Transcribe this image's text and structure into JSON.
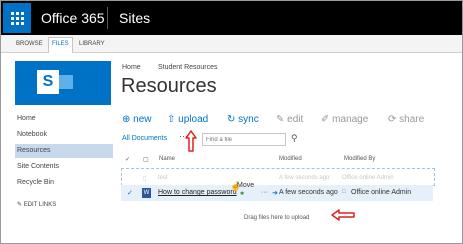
{
  "suite_bar": {
    "app_name": "Office 365",
    "section": "Sites"
  },
  "ribbon": {
    "tabs": [
      "BROWSE",
      "FILES",
      "LIBRARY"
    ],
    "active": "FILES"
  },
  "left_nav": {
    "items": [
      "Home",
      "Notebook",
      "Resources",
      "Site Contents",
      "Recycle Bin"
    ],
    "selected": "Resources",
    "edit_links": "EDIT LINKS"
  },
  "breadcrumb": [
    "Home",
    "Student Resources"
  ],
  "page_title": "Resources",
  "commands": {
    "new": "new",
    "upload": "upload",
    "sync": "sync",
    "edit": "edit",
    "manage": "manage",
    "share": "share"
  },
  "view": {
    "name": "All Documents",
    "more": "···",
    "search_placeholder": "Find a file"
  },
  "table": {
    "headers": {
      "name": "Name",
      "modified": "Modified",
      "modified_by": "Modified By"
    },
    "ghost_row": {
      "name": "test",
      "modified": "A few seconds ago",
      "modified_by": "Office online Admin"
    },
    "row": {
      "name": "How to change password",
      "move_tip": "Move",
      "more": "···",
      "modified": "A few seconds ago",
      "modified_by": "Office online Admin"
    }
  },
  "drag_hint": "Drag files here to upload",
  "icons": [
    "waffle-icon",
    "sharepoint-logo",
    "plus-icon",
    "upload-icon",
    "sync-icon",
    "pencil-icon",
    "wrench-icon",
    "share-icon",
    "search-icon",
    "checkmark-icon",
    "document-icon",
    "annotation-arrow"
  ],
  "colors": {
    "suite_bar": "#000000",
    "accent": "#0072c6",
    "selected_nav": "#c8d9ee",
    "annotation": "#e0201c"
  }
}
